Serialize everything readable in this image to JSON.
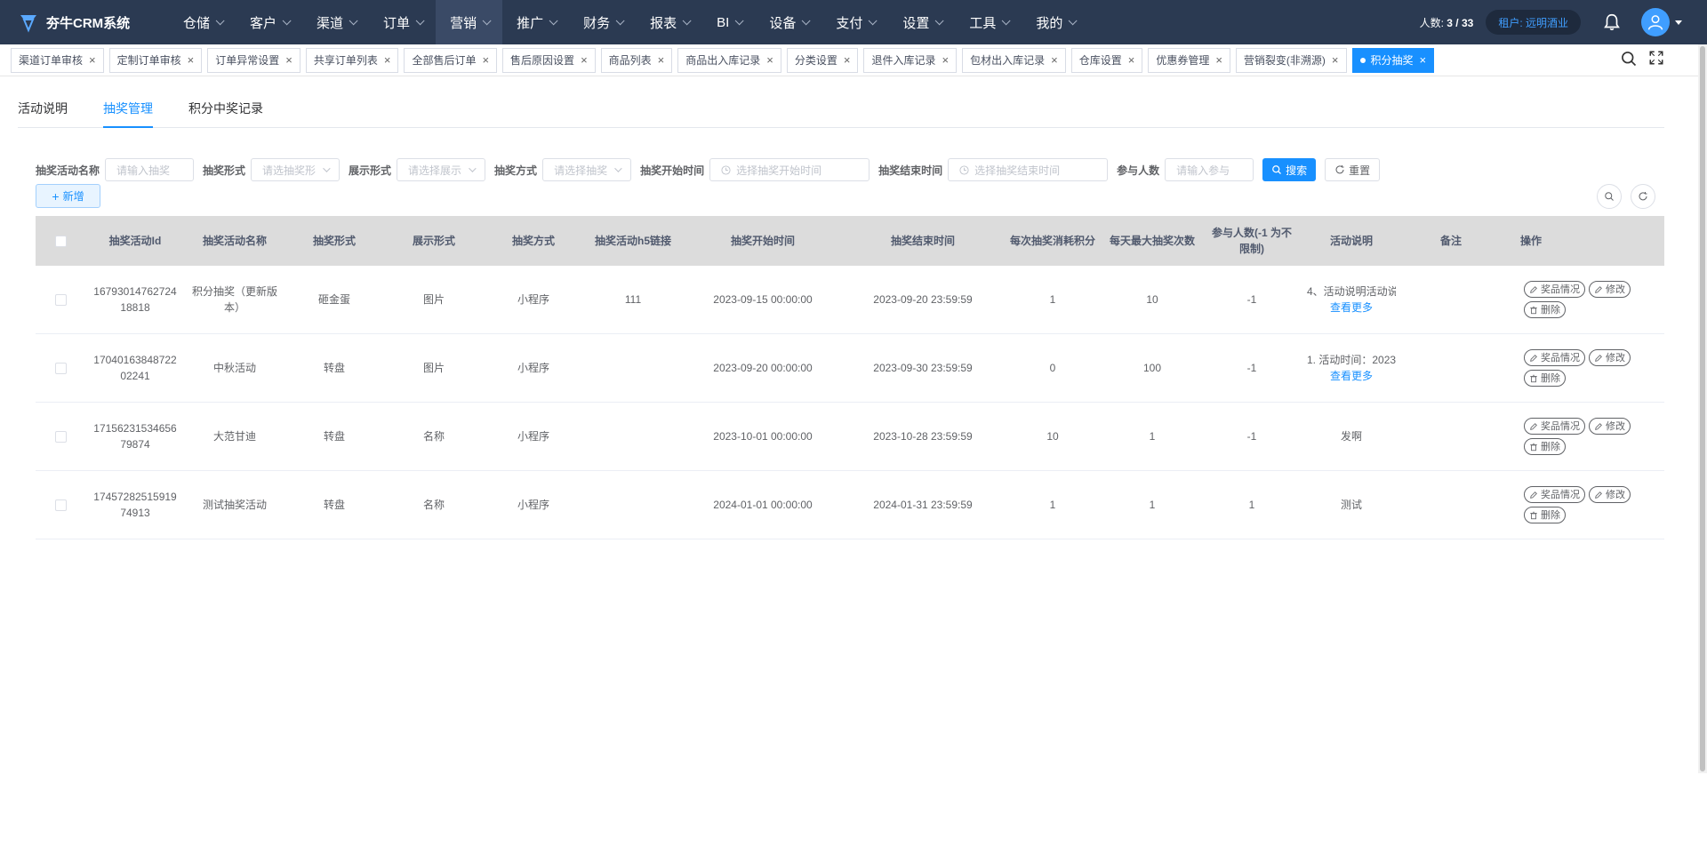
{
  "app": {
    "title": "夯牛CRM系统"
  },
  "nav": {
    "items": [
      {
        "label": "仓储"
      },
      {
        "label": "客户"
      },
      {
        "label": "渠道"
      },
      {
        "label": "订单"
      },
      {
        "label": "营销",
        "active": true
      },
      {
        "label": "推广"
      },
      {
        "label": "财务"
      },
      {
        "label": "报表"
      },
      {
        "label": "BI"
      },
      {
        "label": "设备"
      },
      {
        "label": "支付"
      },
      {
        "label": "设置"
      },
      {
        "label": "工具"
      },
      {
        "label": "我的"
      }
    ],
    "headcount_label": "人数:",
    "headcount_value": "3 / 33",
    "tenant": "租户: 远明酒业"
  },
  "tags": [
    {
      "label": "渠道订单审核"
    },
    {
      "label": "定制订单审核"
    },
    {
      "label": "订单异常设置"
    },
    {
      "label": "共享订单列表"
    },
    {
      "label": "全部售后订单"
    },
    {
      "label": "售后原因设置"
    },
    {
      "label": "商品列表"
    },
    {
      "label": "商品出入库记录"
    },
    {
      "label": "分类设置"
    },
    {
      "label": "退件入库记录"
    },
    {
      "label": "包材出入库记录"
    },
    {
      "label": "仓库设置"
    },
    {
      "label": "优惠券管理"
    },
    {
      "label": "营销裂变(非溯源)"
    },
    {
      "label": "积分抽奖",
      "active": true
    }
  ],
  "tabs": [
    {
      "label": "活动说明"
    },
    {
      "label": "抽奖管理",
      "active": true
    },
    {
      "label": "积分中奖记录"
    }
  ],
  "filters": {
    "name_label": "抽奖活动名称",
    "name_placeholder": "请输入抽奖",
    "form_label": "抽奖形式",
    "form_placeholder": "请选抽奖形",
    "display_label": "展示形式",
    "display_placeholder": "请选择展示",
    "method_label": "抽奖方式",
    "method_placeholder": "请选择抽奖",
    "start_label": "抽奖开始时间",
    "start_placeholder": "选择抽奖开始时间",
    "end_label": "抽奖结束时间",
    "end_placeholder": "选择抽奖结束时间",
    "people_label": "参与人数",
    "people_placeholder": "请输入参与",
    "search_label": "搜索",
    "reset_label": "重置"
  },
  "toolbar": {
    "add_label": "新增"
  },
  "table": {
    "headers": {
      "id": "抽奖活动Id",
      "name": "抽奖活动名称",
      "form": "抽奖形式",
      "display": "展示形式",
      "method": "抽奖方式",
      "h5": "抽奖活动h5链接",
      "start": "抽奖开始时间",
      "end": "抽奖结束时间",
      "cost": "每次抽奖消耗积分",
      "max": "每天最大抽奖次数",
      "people": "参与人数(-1 为不限制)",
      "desc": "活动说明",
      "note": "备注",
      "ops": "操作"
    },
    "more_label": "查看更多",
    "op_prize": "奖品情况",
    "op_edit": "修改",
    "op_delete": "删除",
    "rows": [
      {
        "id": "1679301476272418818",
        "name": "积分抽奖（更新版本）",
        "form": "砸金蛋",
        "display": "图片",
        "method": "小程序",
        "h5": "111",
        "start": "2023-09-15 00:00:00",
        "end": "2023-09-20 23:59:59",
        "cost": "1",
        "max": "10",
        "people": "-1",
        "desc": "4、活动说明活动说",
        "has_more": true,
        "note": ""
      },
      {
        "id": "1704016384872202241",
        "name": "中秋活动",
        "form": "转盘",
        "display": "图片",
        "method": "小程序",
        "h5": "",
        "start": "2023-09-20 00:00:00",
        "end": "2023-09-30 23:59:59",
        "cost": "0",
        "max": "100",
        "people": "-1",
        "desc": "1. 活动时间：2023",
        "has_more": true,
        "note": ""
      },
      {
        "id": "1715623153465679874",
        "name": "大范甘迪",
        "form": "转盘",
        "display": "名称",
        "method": "小程序",
        "h5": "",
        "start": "2023-10-01 00:00:00",
        "end": "2023-10-28 23:59:59",
        "cost": "10",
        "max": "1",
        "people": "-1",
        "desc": "发啊",
        "has_more": false,
        "note": ""
      },
      {
        "id": "1745728251591974913",
        "name": "测试抽奖活动",
        "form": "转盘",
        "display": "名称",
        "method": "小程序",
        "h5": "",
        "start": "2024-01-01 00:00:00",
        "end": "2024-01-31 23:59:59",
        "cost": "1",
        "max": "1",
        "people": "1",
        "desc": "测试",
        "has_more": false,
        "note": ""
      }
    ]
  },
  "colors": {
    "nav_bg": "#2b3a52",
    "primary": "#1890ff",
    "header_bg": "#dcdcdc"
  },
  "icons": [
    "logo-icon",
    "bell-icon",
    "user-icon",
    "search-icon",
    "fullscreen-icon",
    "clock-icon",
    "refresh-icon",
    "plus-icon",
    "edit-icon",
    "delete-icon"
  ]
}
